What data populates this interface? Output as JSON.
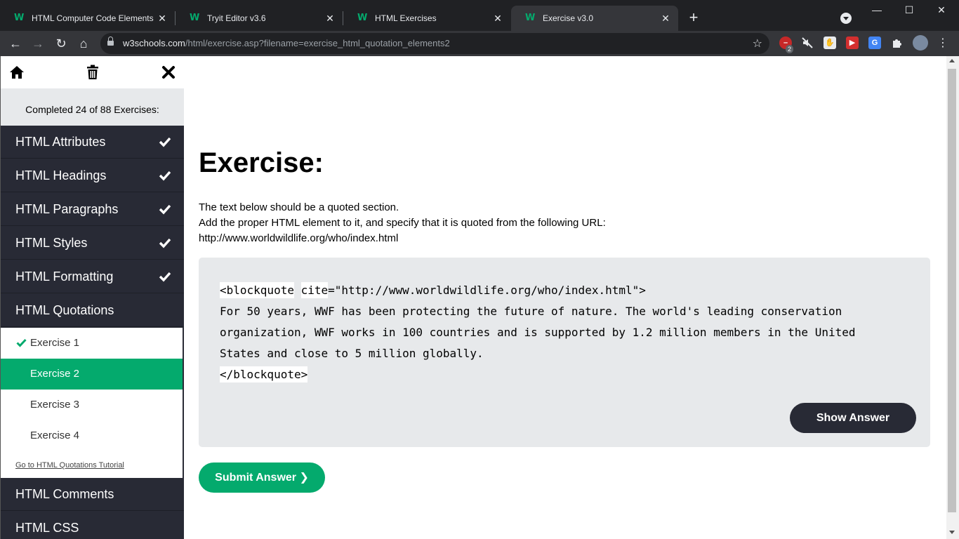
{
  "browser": {
    "tabs": [
      {
        "title": "HTML Computer Code Elements",
        "favicon": "w3schools-icon"
      },
      {
        "title": "Tryit Editor v3.6",
        "favicon": "w3schools-icon"
      },
      {
        "title": "HTML Exercises",
        "favicon": "w3schools-icon"
      },
      {
        "title": "Exercise v3.0",
        "favicon": "w3schools-icon",
        "active": true
      }
    ],
    "url_host": "w3schools.com",
    "url_path": "/html/exercise.asp?filename=exercise_html_quotation_elements2",
    "extension_badge": "2"
  },
  "sidebar": {
    "completed_text": "Completed 24 of 88 Exercises:",
    "categories_top": [
      {
        "label": "HTML Attributes",
        "done": true
      },
      {
        "label": "HTML Headings",
        "done": true
      },
      {
        "label": "HTML Paragraphs",
        "done": true
      },
      {
        "label": "HTML Styles",
        "done": true
      },
      {
        "label": "HTML Formatting",
        "done": true
      },
      {
        "label": "HTML Quotations",
        "done": false
      }
    ],
    "exercises": [
      {
        "label": "Exercise 1",
        "done": true
      },
      {
        "label": "Exercise 2",
        "selected": true
      },
      {
        "label": "Exercise 3"
      },
      {
        "label": "Exercise 4"
      }
    ],
    "tutorial_link": "Go to HTML Quotations Tutorial",
    "categories_bottom": [
      {
        "label": "HTML Comments"
      },
      {
        "label": "HTML CSS"
      }
    ]
  },
  "main": {
    "heading": "Exercise:",
    "instructions": [
      "The text below should be a quoted section.",
      "Add the proper HTML element to it, and specify that it is quoted from the following URL:",
      "http://www.worldwildlife.org/who/index.html"
    ],
    "code": {
      "open_tag": "<blockquote",
      "attr_name": "cite",
      "attr_value": "=\"http://www.worldwildlife.org/who/index.html\">",
      "line2": "For 50 years, WWF has been protecting the future of nature. The world's leading conservation",
      "line3": "organization, WWF works in 100 countries and is supported by 1.2 million members in the United",
      "line4": "States and close to 5 million globally.",
      "close_tag": "</blockquote>"
    },
    "show_answer_label": "Show Answer",
    "submit_label": "Submit Answer ❯"
  },
  "colors": {
    "accent_green": "#04aa6d",
    "sidebar_dark": "#282a35"
  }
}
